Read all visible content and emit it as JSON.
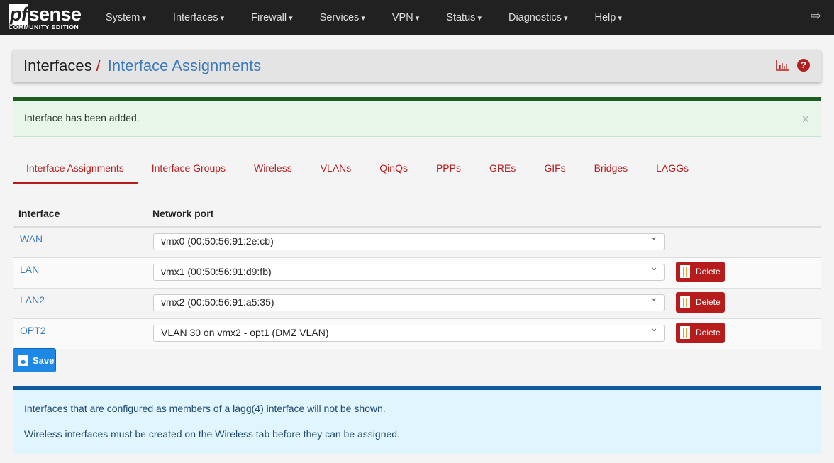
{
  "brand": {
    "name": "pfsense",
    "pf": "pf",
    "sense": "sense",
    "edition": "COMMUNITY EDITION"
  },
  "nav": [
    "System",
    "Interfaces",
    "Firewall",
    "Services",
    "VPN",
    "Status",
    "Diagnostics",
    "Help"
  ],
  "breadcrumb": {
    "parent": "Interfaces",
    "separator": "/",
    "current": "Interface Assignments"
  },
  "alert": {
    "message": "Interface has been added.",
    "close": "×"
  },
  "tabs": [
    "Interface Assignments",
    "Interface Groups",
    "Wireless",
    "VLANs",
    "QinQs",
    "PPPs",
    "GREs",
    "GIFs",
    "Bridges",
    "LAGGs"
  ],
  "table": {
    "headers": [
      "Interface",
      "Network port"
    ],
    "rows": [
      {
        "iface": "WAN",
        "port": "vmx0 (00:50:56:91:2e:cb)"
      },
      {
        "iface": "LAN",
        "port": "vmx1 (00:50:56:91:d9:fb)",
        "action": "Delete"
      },
      {
        "iface": "LAN2",
        "port": "vmx2 (00:50:56:91:a5:35)",
        "action": "Delete"
      },
      {
        "iface": "OPT2",
        "port": "VLAN 30 on vmx2 - opt1 (DMZ VLAN)",
        "action": "Delete"
      }
    ]
  },
  "save_label": "Save",
  "info": [
    "Interfaces that are configured as members of a lagg(4) interface will not be shown.",
    "Wireless interfaces must be created on the Wireless tab before they can be assigned."
  ]
}
